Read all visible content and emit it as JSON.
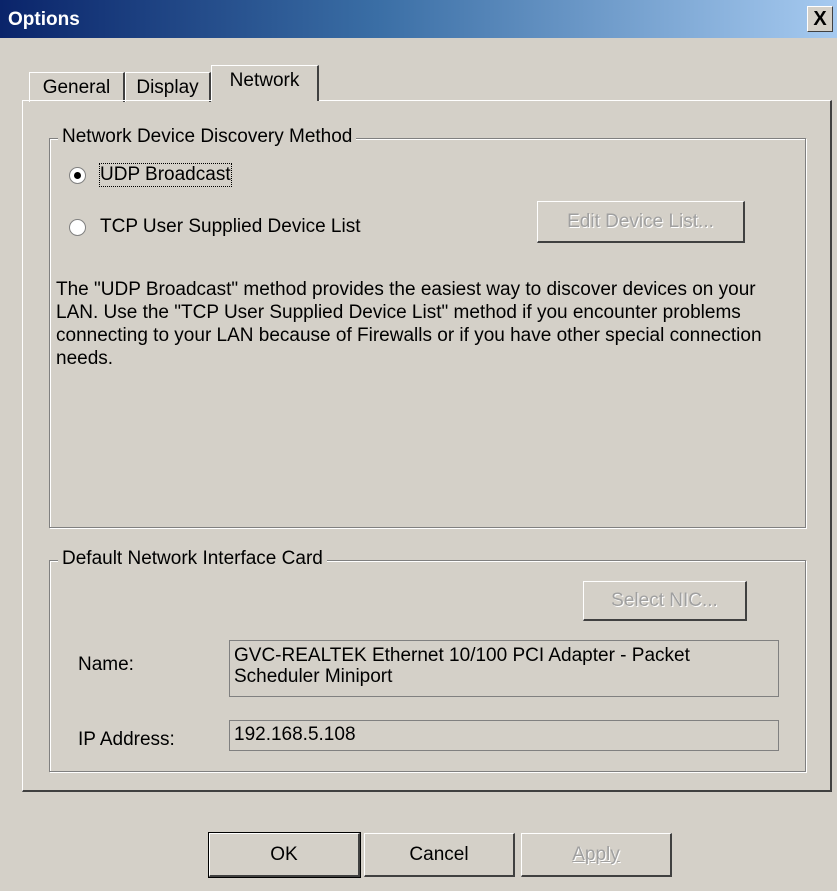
{
  "window": {
    "title": "Options",
    "close_label": "X"
  },
  "tabs": [
    {
      "label": "General",
      "active": false
    },
    {
      "label": "Display",
      "active": false
    },
    {
      "label": "Network",
      "active": true
    }
  ],
  "discovery": {
    "legend": "Network Device Discovery Method",
    "options": [
      {
        "label": "UDP Broadcast",
        "selected": true
      },
      {
        "label": "TCP User Supplied Device List",
        "selected": false
      }
    ],
    "edit_button": "Edit Device List...",
    "description": "The \"UDP Broadcast\" method provides the easiest way to discover devices on your LAN. Use the \"TCP User Supplied Device List\" method if you encounter problems connecting to your LAN because of Firewalls or if you have other special connection needs."
  },
  "nic": {
    "legend": "Default Network Interface Card",
    "select_button": "Select NIC...",
    "name_label": "Name:",
    "name_value": "GVC-REALTEK Ethernet 10/100 PCI Adapter - Packet Scheduler Miniport",
    "ip_label": "IP Address:",
    "ip_value": "192.168.5.108"
  },
  "footer": {
    "ok": "OK",
    "cancel": "Cancel",
    "apply": "Apply"
  }
}
